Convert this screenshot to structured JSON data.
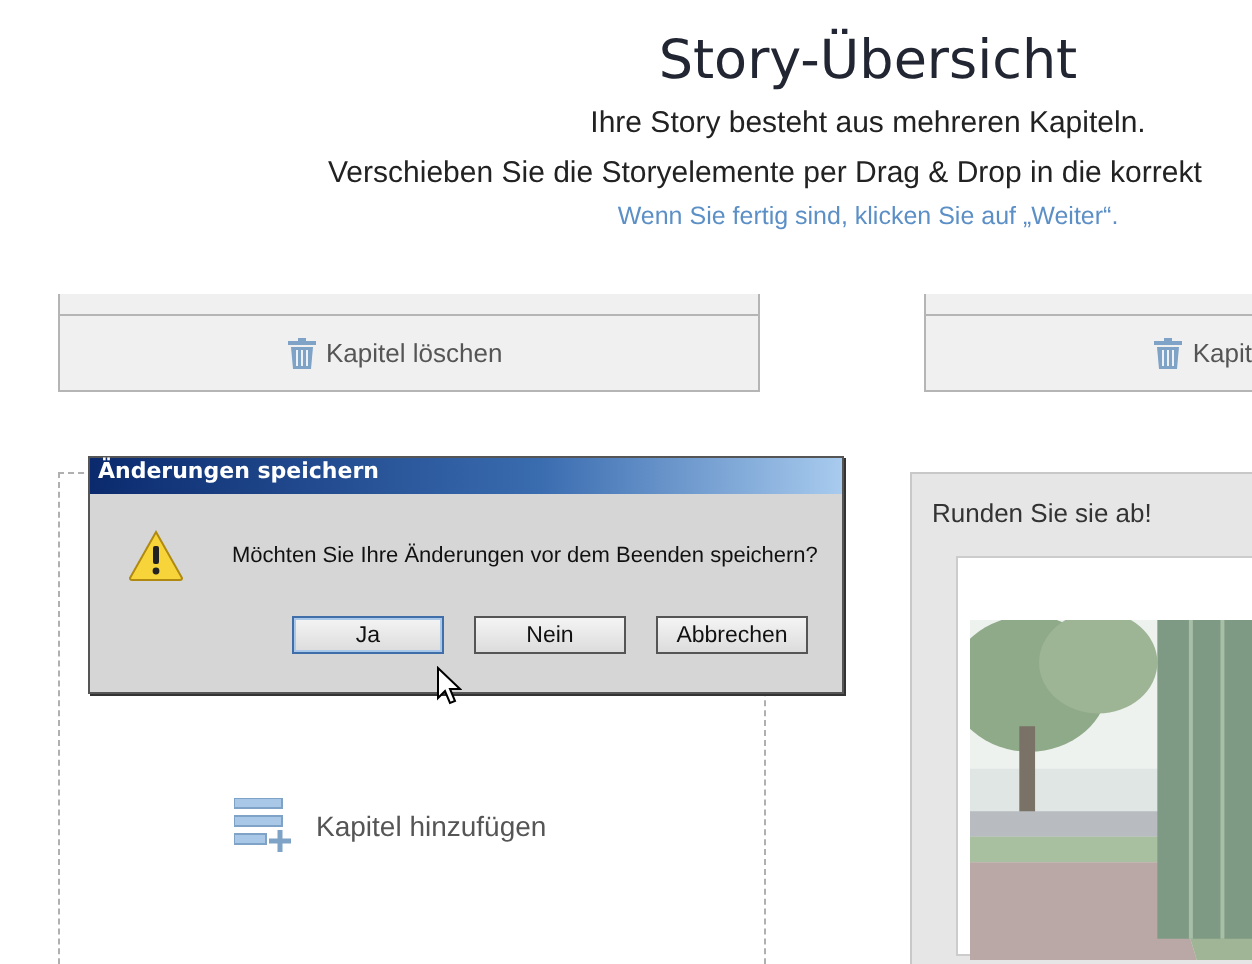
{
  "header": {
    "title": "Story-Übersicht",
    "intro": "Ihre Story besteht aus mehreren Kapiteln.",
    "instruction": "Verschieben Sie die Storyelemente per Drag & Drop in die korrekt",
    "hint": "Wenn Sie fertig sind, klicken Sie auf „Weiter“."
  },
  "chapters": [
    {
      "delete_label": "Kapitel löschen"
    },
    {
      "delete_label": "Kapit"
    }
  ],
  "add_chapter": {
    "label": "Kapitel hinzufügen"
  },
  "panel": {
    "title": "Runden Sie sie ab!"
  },
  "dialog": {
    "title": "Änderungen speichern",
    "message": "Möchten Sie Ihre Änderungen vor dem Beenden speichern?",
    "buttons": [
      {
        "label": "Ja",
        "selected": true
      },
      {
        "label": "Nein",
        "selected": false
      },
      {
        "label": "Abbrechen",
        "selected": false
      }
    ]
  }
}
